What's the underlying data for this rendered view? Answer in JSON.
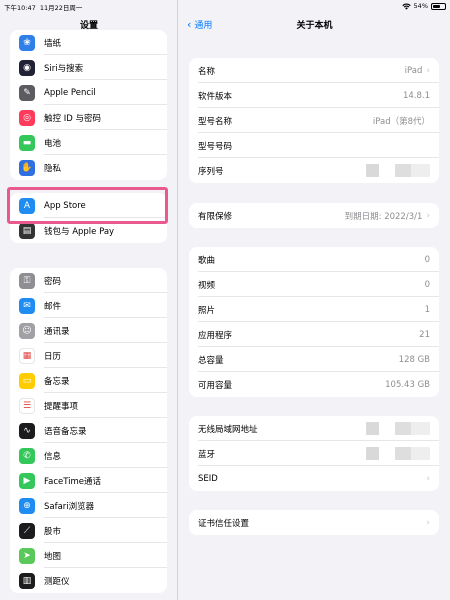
{
  "statusbar": {
    "time": "下午10:47",
    "date": "11月22日周一",
    "battery": "54%"
  },
  "sidebar": {
    "title": "设置",
    "group1": [
      {
        "label": "墙纸",
        "icon": "wallpaper-icon",
        "color": "#2f7fe8",
        "glyph": "❀"
      },
      {
        "label": "Siri与搜索",
        "icon": "siri-icon",
        "color": "#222236",
        "glyph": "◉"
      },
      {
        "label": "Apple Pencil",
        "icon": "pencil-icon",
        "color": "#5b5b60",
        "glyph": "✎"
      },
      {
        "label": "触控 ID 与密码",
        "icon": "touch-id-icon",
        "color": "#ff3b5c",
        "glyph": "◎"
      },
      {
        "label": "电池",
        "icon": "battery-icon",
        "color": "#34c759",
        "glyph": "▬"
      },
      {
        "label": "隐私",
        "icon": "privacy-hand-icon",
        "color": "#2f6fe4",
        "glyph": "✋"
      }
    ],
    "group2": [
      {
        "label": "App Store",
        "icon": "app-store-icon",
        "color": "#1e8cf0",
        "glyph": "A"
      },
      {
        "label": "钱包与 Apple Pay",
        "icon": "wallet-icon",
        "color": "#333333",
        "glyph": "▤"
      }
    ],
    "group3": [
      {
        "label": "密码",
        "icon": "key-icon",
        "color": "#8e8e93",
        "glyph": "⚿"
      },
      {
        "label": "邮件",
        "icon": "mail-icon",
        "color": "#1e8cf0",
        "glyph": "✉"
      },
      {
        "label": "通讯录",
        "icon": "contacts-icon",
        "color": "#a0a0a5",
        "glyph": "☺"
      },
      {
        "label": "日历",
        "icon": "calendar-icon",
        "color": "#ffffff",
        "glyph": "▦"
      },
      {
        "label": "备忘录",
        "icon": "notes-icon",
        "color": "#ffcc00",
        "glyph": "▭"
      },
      {
        "label": "提醒事项",
        "icon": "reminders-icon",
        "color": "#ffffff",
        "glyph": "☰"
      },
      {
        "label": "语音备忘录",
        "icon": "voice-memos-icon",
        "color": "#1c1c1e",
        "glyph": "∿"
      },
      {
        "label": "信息",
        "icon": "messages-icon",
        "color": "#34c759",
        "glyph": "✆"
      },
      {
        "label": "FaceTime通话",
        "icon": "facetime-icon",
        "color": "#34c759",
        "glyph": "▶"
      },
      {
        "label": "Safari浏览器",
        "icon": "safari-icon",
        "color": "#1e8cf0",
        "glyph": "⊕"
      },
      {
        "label": "股市",
        "icon": "stocks-icon",
        "color": "#1c1c1e",
        "glyph": "⟋"
      },
      {
        "label": "地图",
        "icon": "maps-icon",
        "color": "#5ac85a",
        "glyph": "➤"
      },
      {
        "label": "测距仪",
        "icon": "measure-icon",
        "color": "#1c1c1e",
        "glyph": "▥"
      }
    ]
  },
  "nav": {
    "back_label": "通用",
    "title": "关于本机"
  },
  "about": {
    "card1": [
      {
        "key": "名称",
        "value": "iPad",
        "chevron": true
      },
      {
        "key": "软件版本",
        "value": "14.8.1"
      },
      {
        "key": "型号名称",
        "value": "iPad（第8代）"
      },
      {
        "key": "型号号码",
        "value": ""
      },
      {
        "key": "序列号",
        "value": "",
        "redacted": true
      }
    ],
    "card2": [
      {
        "key": "有限保修",
        "value": "到期日期: 2022/3/1",
        "chevron": true
      }
    ],
    "card3": [
      {
        "key": "歌曲",
        "value": "0"
      },
      {
        "key": "视频",
        "value": "0"
      },
      {
        "key": "照片",
        "value": "1"
      },
      {
        "key": "应用程序",
        "value": "21"
      },
      {
        "key": "总容量",
        "value": "128 GB"
      },
      {
        "key": "可用容量",
        "value": "105.43 GB"
      }
    ],
    "card4": [
      {
        "key": "无线局域网地址",
        "value": "",
        "redacted": true
      },
      {
        "key": "蓝牙",
        "value": "",
        "redacted": true
      },
      {
        "key": "SEID",
        "value": "",
        "chevron": true
      }
    ],
    "card5": [
      {
        "key": "证书信任设置",
        "value": "",
        "chevron": true
      }
    ]
  }
}
